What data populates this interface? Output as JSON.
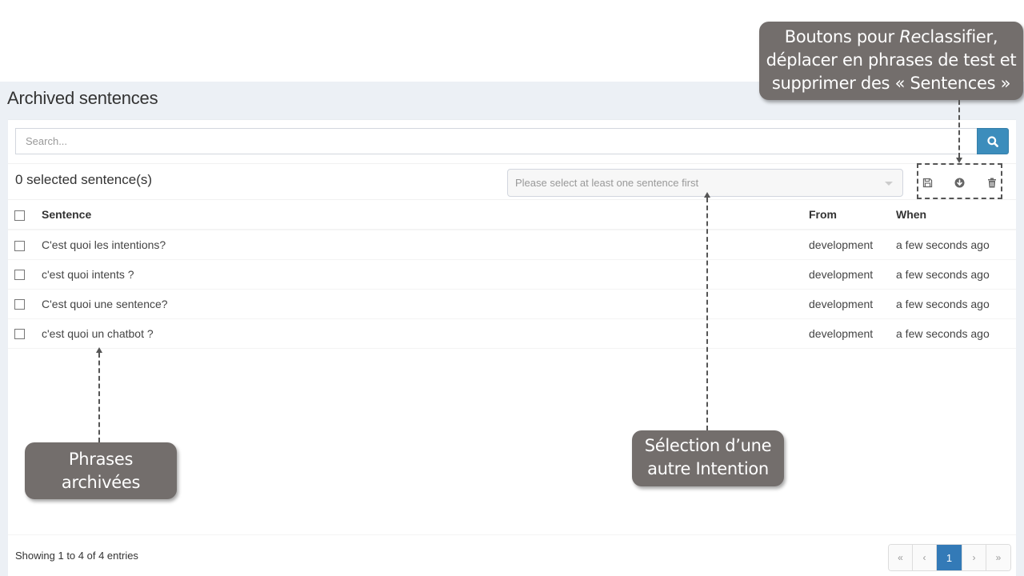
{
  "page": {
    "title": "Archived sentences"
  },
  "search": {
    "placeholder": "Search...",
    "value": "",
    "button_icon": "search-icon"
  },
  "toolbar": {
    "selected_count_text": "0 selected sentence(s)",
    "intent_select_placeholder": "Please select at least one sentence first",
    "actions": [
      {
        "name": "reclassify",
        "icon": "save-icon"
      },
      {
        "name": "move-to-test",
        "icon": "arrow-circle-down-icon"
      },
      {
        "name": "delete",
        "icon": "trash-icon"
      }
    ]
  },
  "table": {
    "columns": [
      "Sentence",
      "From",
      "When"
    ],
    "rows": [
      {
        "sentence": "C'est quoi les intentions?",
        "from": "development",
        "when": "a few seconds ago",
        "checked": false
      },
      {
        "sentence": "c'est quoi intents ?",
        "from": "development",
        "when": "a few seconds ago",
        "checked": false
      },
      {
        "sentence": "C'est quoi une sentence?",
        "from": "development",
        "when": "a few seconds ago",
        "checked": false
      },
      {
        "sentence": "c'est quoi un chatbot ?",
        "from": "development",
        "when": "a few seconds ago",
        "checked": false
      }
    ]
  },
  "footer": {
    "info": "Showing 1 to 4 of 4 entries",
    "pagination": {
      "first": "«",
      "prev": "‹",
      "current": "1",
      "next": "›",
      "last": "»"
    }
  },
  "callouts": {
    "buttons": {
      "line1_pre": "Boutons pour ",
      "line1_em": "Re",
      "line1_post": "classifier,",
      "line2": "déplacer en phrases de test et",
      "line3": "supprimer des « Sentences »"
    },
    "archived": {
      "line1": "Phrases",
      "line2": "archivées"
    },
    "intent": {
      "line1": "Sélection d’une",
      "line2": "autre Intention"
    }
  },
  "colors": {
    "primary": "#3c8dbc",
    "pagination_active": "#337ab7",
    "callout_bg": "#736e6c",
    "content_bg": "#ecf0f5"
  }
}
